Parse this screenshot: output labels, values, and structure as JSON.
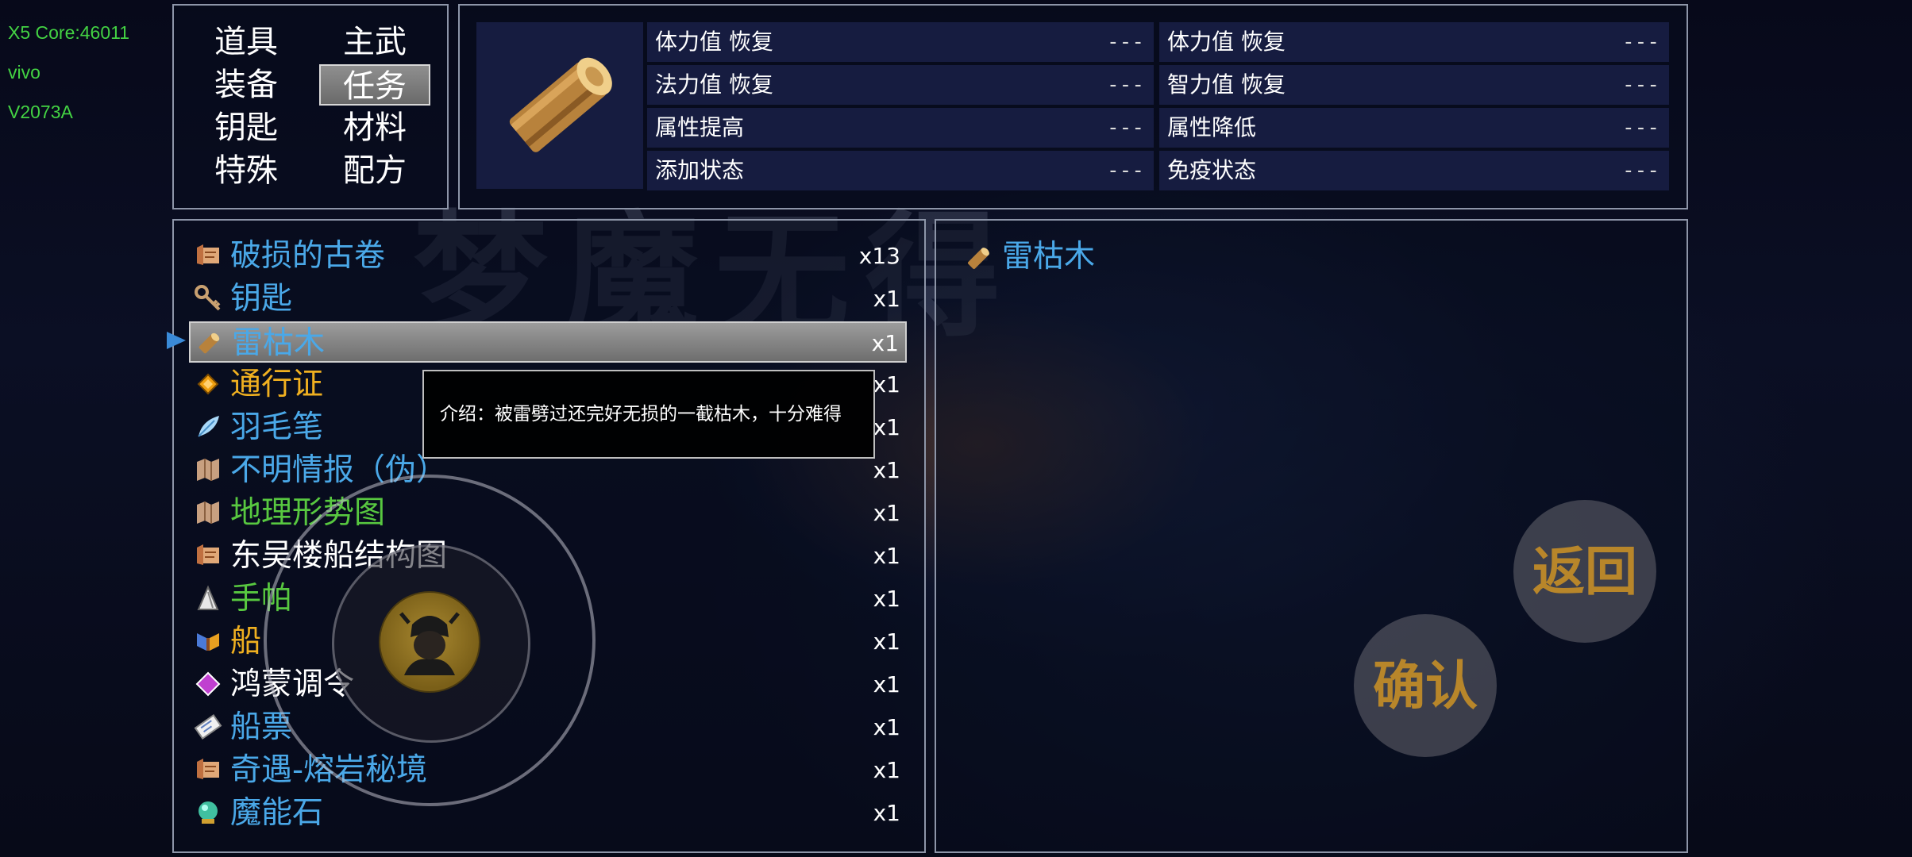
{
  "device": {
    "core": "X5 Core:46011",
    "brand": "vivo",
    "model": "V2073A"
  },
  "watermark_text": "梦魔无得",
  "categories": [
    {
      "label": "道具"
    },
    {
      "label": "主武"
    },
    {
      "label": "装备"
    },
    {
      "label": "任务",
      "active": true
    },
    {
      "label": "钥匙"
    },
    {
      "label": "材料"
    },
    {
      "label": "特殊"
    },
    {
      "label": "配方"
    }
  ],
  "item_preview": {
    "icon": "wooden-log-icon"
  },
  "stats": [
    {
      "label": "体力值 恢复",
      "value": "---"
    },
    {
      "label": "体力值 恢复",
      "value": "---"
    },
    {
      "label": "法力值 恢复",
      "value": "---"
    },
    {
      "label": "智力值 恢复",
      "value": "---"
    },
    {
      "label": "属性提高",
      "value": "---"
    },
    {
      "label": "属性降低",
      "value": "---"
    },
    {
      "label": "添加状态",
      "value": "---"
    },
    {
      "label": "免疫状态",
      "value": "---"
    }
  ],
  "items": [
    {
      "name": "破损的古卷",
      "qty": "x13",
      "color": "#4aa8e8",
      "icon": "scroll-icon"
    },
    {
      "name": "钥匙",
      "qty": "x1",
      "color": "#4aa8e8",
      "icon": "key-icon"
    },
    {
      "name": "雷枯木",
      "qty": "x1",
      "color": "#4aa8e8",
      "icon": "wooden-log-icon",
      "selected": true
    },
    {
      "name": "通行证",
      "qty": "x1",
      "color": "#f0b020",
      "icon": "diamond-token-icon"
    },
    {
      "name": "羽毛笔",
      "qty": "x1",
      "color": "#4aa8e8",
      "icon": "feather-icon"
    },
    {
      "name": "不明情报（伪）",
      "qty": "x1",
      "color": "#4aa8e8",
      "icon": "map-icon"
    },
    {
      "name": "地理形势图",
      "qty": "x1",
      "color": "#58c840",
      "icon": "map-icon"
    },
    {
      "name": "东吴楼船结构图",
      "qty": "x1",
      "color": "#ffffff",
      "icon": "scroll-icon"
    },
    {
      "name": "手帕",
      "qty": "x1",
      "color": "#58c840",
      "icon": "cloth-icon"
    },
    {
      "name": "船",
      "qty": "x1",
      "color": "#f0b020",
      "icon": "boat-icon"
    },
    {
      "name": "鸿蒙调令",
      "qty": "x1",
      "color": "#ffffff",
      "icon": "purple-diamond-icon"
    },
    {
      "name": "船票",
      "qty": "x1",
      "color": "#4aa8e8",
      "icon": "ticket-icon"
    },
    {
      "name": "奇遇-熔岩秘境",
      "qty": "x1",
      "color": "#4aa8e8",
      "icon": "scroll-icon"
    },
    {
      "name": "魔能石",
      "qty": "x1",
      "color": "#4aa8e8",
      "icon": "orb-icon"
    }
  ],
  "tooltip": {
    "text": "介绍：被雷劈过还完好无损的一截枯木，十分难得"
  },
  "selected_item": {
    "name": "雷枯木",
    "color": "#4aa8e8",
    "icon": "wooden-log-icon"
  },
  "buttons": {
    "back_label": "返回",
    "confirm_label": "确认"
  },
  "joystick": {
    "icon": "warrior-avatar-icon"
  }
}
